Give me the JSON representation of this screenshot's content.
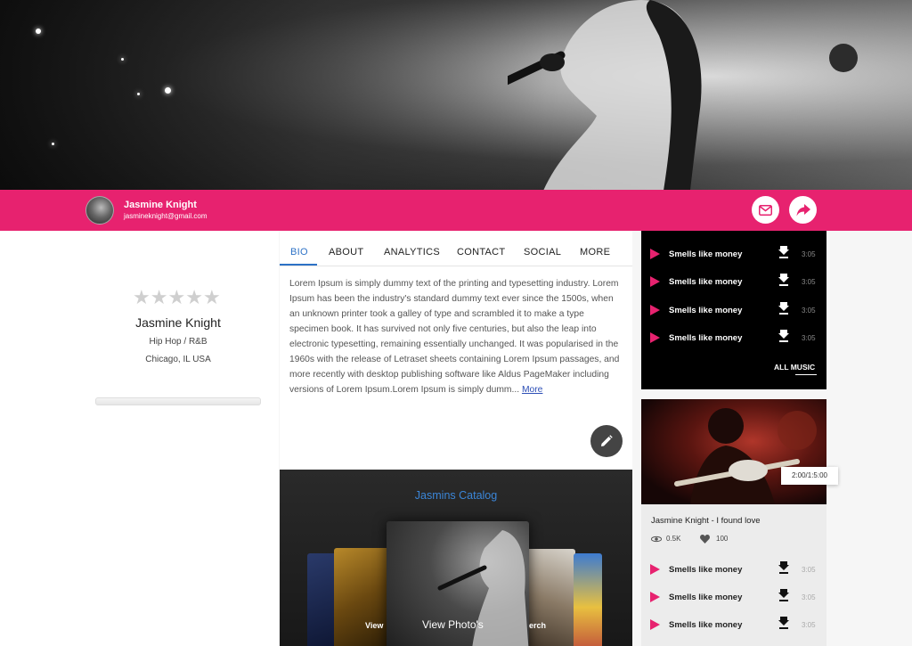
{
  "profile": {
    "name": "Jasmine Knight",
    "email": "jasmineknight@gmail.com",
    "genre": "Hip Hop / R&B",
    "location": "Chicago, IL USA",
    "rating": 0,
    "rating_max": 5
  },
  "actions": {
    "mail_icon": "mail-icon",
    "share_icon": "share-icon"
  },
  "tabs": [
    {
      "label": "BIO",
      "active": true
    },
    {
      "label": "ABOUT",
      "active": false
    },
    {
      "label": "ANALYTICS",
      "active": false
    },
    {
      "label": "CONTACT",
      "active": false
    },
    {
      "label": "SOCIAL",
      "active": false
    },
    {
      "label": "MORE",
      "active": false
    }
  ],
  "bio": {
    "text": "Lorem Ipsum is simply dummy text of the printing and typesetting industry. Lorem Ipsum has been the industry's standard dummy text ever since the 1500s, when an unknown printer took a galley of type and scrambled it to make a type specimen book. It has survived not only five centuries, but also the leap into electronic typesetting, remaining essentially unchanged. It was popularised in the 1960s with the release of Letraset sheets containing Lorem Ipsum passages, and more recently with desktop publishing software like Aldus PageMaker including versions of Lorem Ipsum.Lorem Ipsum is simply dumm...",
    "more_label": "More"
  },
  "catalog": {
    "title": "Jasmins Catalog",
    "view_photos": "View Photo's",
    "left_label": "View",
    "right_label": "erch"
  },
  "music": {
    "tracks": [
      {
        "title": "Smells like money",
        "duration": "3:05"
      },
      {
        "title": "Smells like money",
        "duration": "3:05"
      },
      {
        "title": "Smells like money",
        "duration": "3:05"
      },
      {
        "title": "Smells like money",
        "duration": "3:05"
      }
    ],
    "all_music_label": "ALL MUSIC"
  },
  "video": {
    "time": "2:00/1:5:00",
    "title": "Jasmine Knight - I found love",
    "views": "0.5K",
    "likes": "100",
    "tracks": [
      {
        "title": "Smells like money",
        "duration": "3:05"
      },
      {
        "title": "Smells like money",
        "duration": "3:05"
      },
      {
        "title": "Smells like money",
        "duration": "3:05"
      }
    ]
  },
  "colors": {
    "accent": "#e7226f",
    "link": "#2d72c6",
    "catalog_title": "#3b86d8"
  }
}
